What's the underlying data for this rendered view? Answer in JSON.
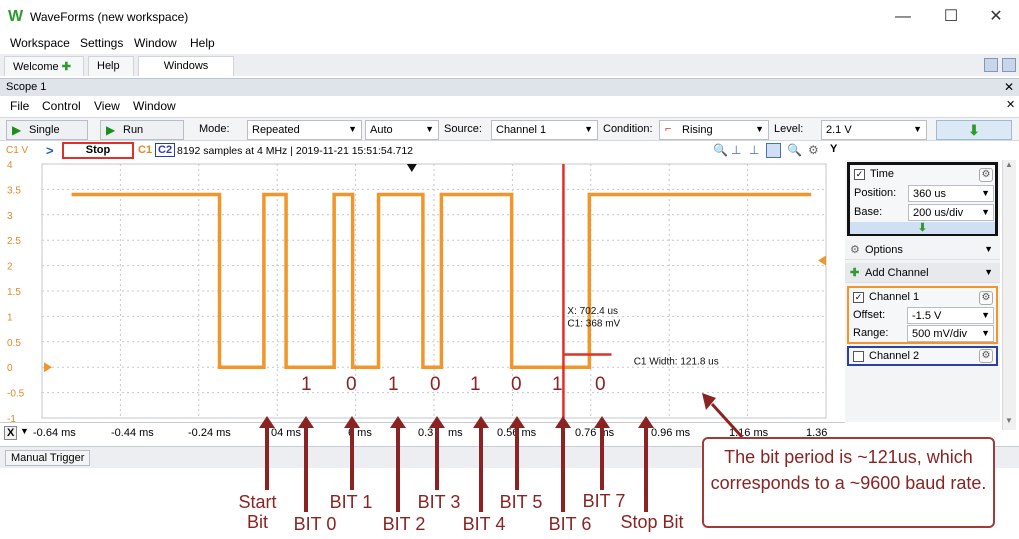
{
  "window": {
    "title": "WaveForms (new workspace)",
    "minimize": "—",
    "maximize": "☐",
    "close": "✕"
  },
  "menu": [
    "Workspace",
    "Settings",
    "Window",
    "Help"
  ],
  "tabs": {
    "welcome": "Welcome",
    "help": "Help",
    "windows": "Windows"
  },
  "scope": {
    "title": "Scope 1",
    "menu": [
      "File",
      "Control",
      "View",
      "Window"
    ]
  },
  "toolbar": {
    "single": "Single",
    "run": "Run",
    "mode_label": "Mode:",
    "mode_value": "Repeated",
    "auto_value": "Auto",
    "source_label": "Source:",
    "source_value": "Channel 1",
    "condition_label": "Condition:",
    "condition_value": "Rising",
    "level_label": "Level:",
    "level_value": "2.1 V"
  },
  "status": {
    "c1v": "C1 V",
    "stop": "Stop",
    "c1": "C1",
    "c2": "C2",
    "info": "8192 samples at 4 MHz | 2019-11-21 15:51:54.712",
    "y_button": "Y"
  },
  "chart_data": {
    "type": "line",
    "y_ticks": [
      "4",
      "3.5",
      "3",
      "2.5",
      "2",
      "1.5",
      "1",
      "0.5",
      "0",
      "-0.5",
      "-1"
    ],
    "x_ticks": [
      "-0.64 ms",
      "-0.44 ms",
      "-0.24 ms",
      "0.04 ms",
      "0.16 ms",
      "0.36 ms",
      "0.56 ms",
      "0.76 ms",
      "0.96 ms",
      "1.16 ms",
      "1.36 ms"
    ],
    "x_labels_shown": [
      "-0.64 ms",
      "-0.44 ms",
      "-0.24 ms",
      "04 ms",
      "6 ms",
      "0.3",
      "ms",
      "0.56 ms",
      "0.76 ms",
      "0.96 ms",
      "1.16 ms",
      "1.36 ms"
    ],
    "series": [
      {
        "name": "C1",
        "color": "#f0962a",
        "x": [
          -0.64,
          -0.24,
          -0.24,
          -0.12,
          -0.12,
          -0.06,
          -0.06,
          0.07,
          0.07,
          0.12,
          0.12,
          0.19,
          0.19,
          0.31,
          0.31,
          0.36,
          0.36,
          0.55,
          0.55,
          0.76,
          0.76,
          1.36
        ],
        "y": [
          3.4,
          3.4,
          0.0,
          0.0,
          3.4,
          3.4,
          0.0,
          0.0,
          3.4,
          3.4,
          0.0,
          0.0,
          3.4,
          3.4,
          0.0,
          0.0,
          3.4,
          3.4,
          0.0,
          0.0,
          3.4,
          3.4
        ]
      }
    ],
    "ylim": [
      -1,
      4
    ],
    "xlim": [
      -0.72,
      1.4
    ],
    "cursor": {
      "x_label": "X: 702.4 us",
      "c1_label": "C1: 368 mV",
      "width_label": "C1 Width: 121.8 us"
    },
    "grid": true
  },
  "right_panel": {
    "time_label": "Time",
    "position_label": "Position:",
    "position_value": "360 us",
    "base_label": "Base:",
    "base_value": "200 us/div",
    "options_label": "Options",
    "add_channel_label": "Add Channel",
    "channel1_label": "Channel 1",
    "offset_label": "Offset:",
    "offset_value": "-1.5 V",
    "range_label": "Range:",
    "range_value": "500 mV/div",
    "channel2_label": "Channel 2"
  },
  "xaxis_bar": {
    "x_button": "X"
  },
  "manual_trigger": "Manual Trigger",
  "annotations": {
    "bit_values": [
      "1",
      "0",
      "1",
      "0",
      "1",
      "0",
      "1",
      "0"
    ],
    "labels": [
      "Start\nBit",
      "BIT 0",
      "BIT 1",
      "BIT 2",
      "BIT 3",
      "BIT 4",
      "BIT 5",
      "BIT 6",
      "BIT 7",
      "Stop Bit"
    ],
    "note": "The bit period is ~121us, which corresponds to a ~9600 baud rate."
  },
  "colors": {
    "trace": "#f0962a",
    "cursor": "#e0302a",
    "annotation": "#8b2323",
    "time_box": "#111111",
    "channel1_box": "#f0962a",
    "channel2_box": "#2a3fa8"
  }
}
